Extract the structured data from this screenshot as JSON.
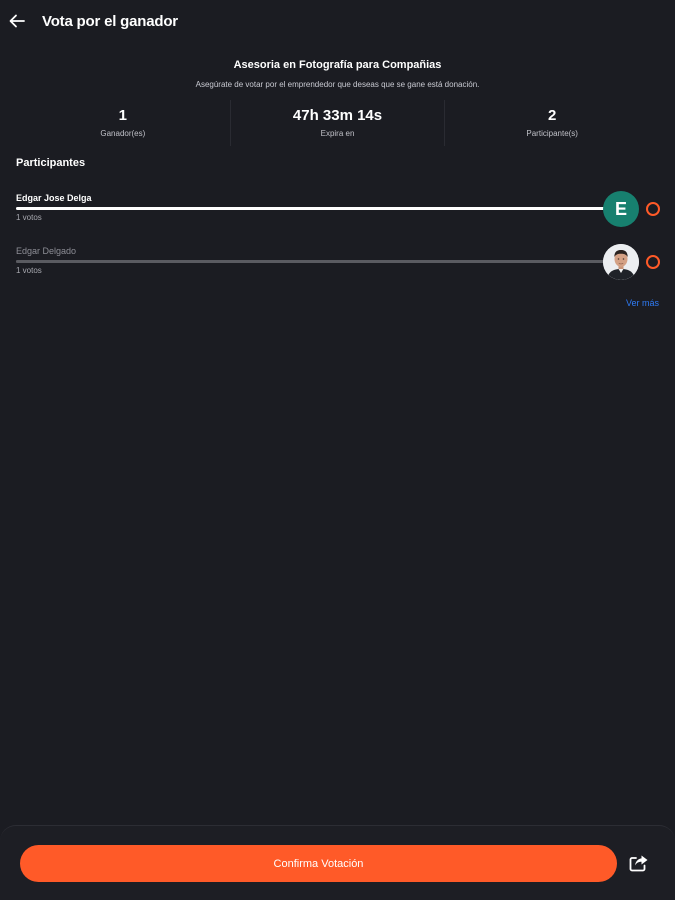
{
  "header": {
    "title": "Vota por el ganador",
    "back_icon": "arrow-left-icon"
  },
  "campaign": {
    "title": "Asesoria en Fotografía para Compañias",
    "subtitle": "Asegúrate de votar por el emprendedor que deseas que se gane está donación."
  },
  "stats": [
    {
      "value": "1",
      "label": "Ganador(es)"
    },
    {
      "value": "47h 33m 14s",
      "label": "Expira en"
    },
    {
      "value": "2",
      "label": "Participante(s)"
    }
  ],
  "participants_section": {
    "title": "Participantes",
    "items": [
      {
        "name": "Edgar Jose Delga",
        "votes": "1 votos",
        "avatar_letter": "E",
        "selected": true,
        "vote_share": 1.0
      },
      {
        "name": "Edgar Delgado",
        "votes": "1 votos",
        "avatar_icon": "person-photo-icon",
        "selected": false,
        "vote_share": 1.0
      }
    ],
    "see_more": "Ver más"
  },
  "footer": {
    "confirm_label": "Confirma Votación",
    "share_icon": "share-icon"
  },
  "colors": {
    "background": "#1b1c22",
    "accent": "#ff5a28",
    "link": "#2f7bf5",
    "avatar_teal": "#17806f"
  }
}
